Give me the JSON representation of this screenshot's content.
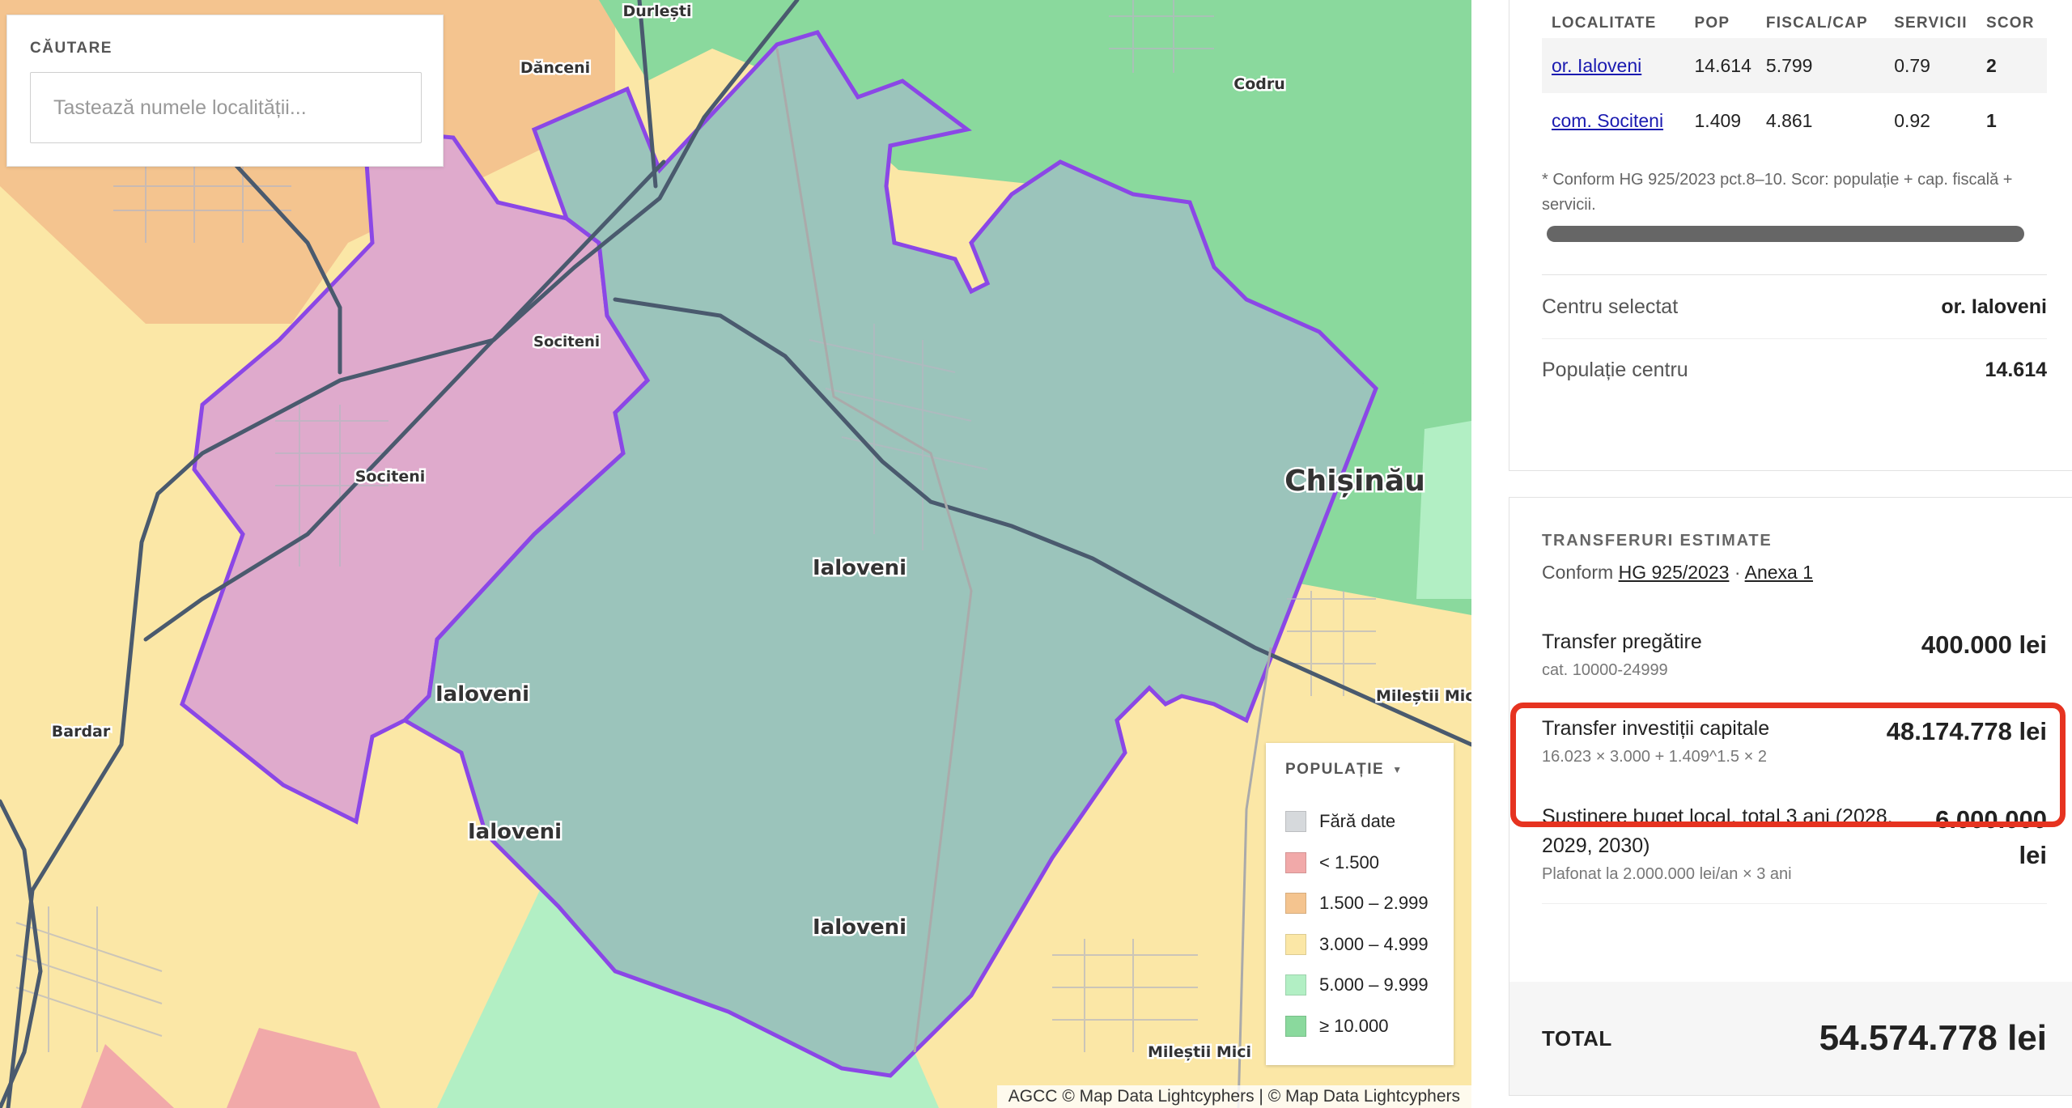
{
  "map": {
    "labels": {
      "durlesti": "Durlești",
      "danceni": "Dănceni",
      "codru": "Codru",
      "socitenil1": "Sociteni",
      "socitenil2": "Sociteni",
      "chisinau": "Chișinău",
      "ialoveni1": "Ialoveni",
      "ialoveni2": "Ialoveni",
      "ialoveni3": "Ialoveni",
      "ialoveni4": "Ialoveni",
      "bardar": "Bardar",
      "milestii1": "Mileștii Mici",
      "milestii2": "Mileștii Mici"
    },
    "colors": {
      "selected_center": "#9bc4bb",
      "selected_neighbor": "#dfaacc",
      "boundary": "#8b47e6",
      "road": "#4a5a6e"
    }
  },
  "search": {
    "title": "CĂUTARE",
    "placeholder": "Tastează numele localității..."
  },
  "legend": {
    "title": "POPULAȚIE",
    "items": [
      {
        "label": "Fără date",
        "color": "#d6d9dc"
      },
      {
        "label": "< 1.500",
        "color": "#f1a9a9"
      },
      {
        "label": "1.500 – 2.999",
        "color": "#f4c48f"
      },
      {
        "label": "3.000 – 4.999",
        "color": "#fbe7a6"
      },
      {
        "label": "5.000 – 9.999",
        "color": "#b2efc4"
      },
      {
        "label": "≥ 10.000",
        "color": "#8ad99d"
      }
    ]
  },
  "attribution": {
    "agcc": "AGCC",
    "link1": "© Map Data Lightcyphers",
    "sep": "|",
    "link2": "© Map Data Lightcyphers"
  },
  "ranking": {
    "headers": [
      "LOCALITATE",
      "POP",
      "FISCAL/CAP",
      "SERVICII",
      "SCOR"
    ],
    "rows": [
      {
        "name": "or. Ialoveni",
        "pop": "14.614",
        "fiscal": "5.799",
        "services": "0.79",
        "score": "2"
      },
      {
        "name": "com. Sociteni",
        "pop": "1.409",
        "fiscal": "4.861",
        "services": "0.92",
        "score": "1"
      }
    ],
    "footnote": "* Conform HG 925/2023 pct.8–10. Scor: populație + cap. fiscală + servicii."
  },
  "summary": {
    "center_label": "Centru selectat",
    "center_value": "or. Ialoveni",
    "pop_label": "Populație centru",
    "pop_value": "14.614"
  },
  "transfers": {
    "title": "TRANSFERURI ESTIMATE",
    "conform": "Conform",
    "link1": "HG 925/2023",
    "dot": "·",
    "link2": "Anexa 1",
    "prep_label": "Transfer pregătire",
    "prep_note": "cat. 10000-24999",
    "prep_value": "400.000 lei",
    "cap_label": "Transfer investiții capitale",
    "cap_note": "16.023 × 3.000 + 1.409^1.5 × 2",
    "cap_value": "48.174.778 lei",
    "budget_label": "Susținere buget local, total 3 ani (2028, 2029, 2030)",
    "budget_note": "Plafonat la 2.000.000 lei/an × 3 ani",
    "budget_value": "6.000.000 lei",
    "total_label": "TOTAL",
    "total_value": "54.574.778 lei"
  }
}
